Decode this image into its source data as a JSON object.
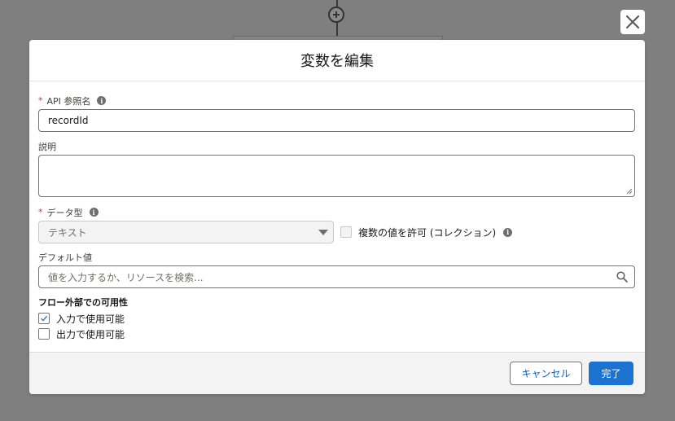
{
  "modal": {
    "title": "変数を編集",
    "close_icon": "close-icon"
  },
  "fields": {
    "api_name": {
      "required": "*",
      "label": "API 参照名",
      "value": "recordId"
    },
    "description": {
      "label": "説明",
      "value": ""
    },
    "data_type": {
      "required": "*",
      "label": "データ型",
      "selected": "テキスト"
    },
    "allow_multiple": {
      "label": "複数の値を許可 (コレクション)",
      "checked": false,
      "disabled": true
    },
    "default_value": {
      "label": "デフォルト値",
      "placeholder": "値を入力するか、リソースを検索..."
    }
  },
  "availability": {
    "title": "フロー外部での可用性",
    "options": [
      {
        "label": "入力で使用可能",
        "checked": true
      },
      {
        "label": "出力で使用可能",
        "checked": false
      }
    ]
  },
  "footer": {
    "cancel_label": "キャンセル",
    "done_label": "完了"
  },
  "colors": {
    "overlay": "#7f7f7f",
    "brand": "#1b72d0",
    "required": "#c23934"
  }
}
